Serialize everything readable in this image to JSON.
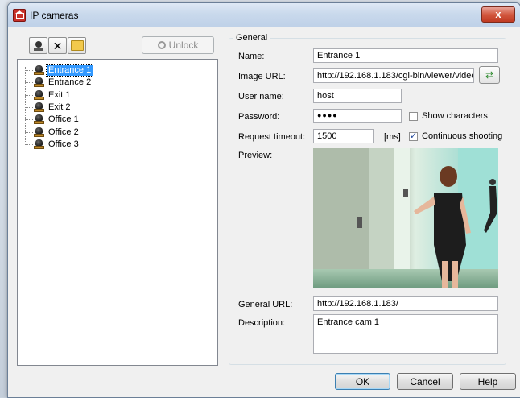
{
  "window": {
    "title": "IP cameras",
    "close_glyph": "x"
  },
  "toolbar": {
    "add_icon": "camera-add-icon",
    "delete_icon": "delete-x-icon",
    "folder_icon": "open-folder-icon",
    "unlock_label": "Unlock"
  },
  "cameras": [
    "Entrance 1",
    "Entrance 2",
    "Exit 1",
    "Exit 2",
    "Office 1",
    "Office 2",
    "Office 3"
  ],
  "selected_camera": "Entrance 1",
  "general": {
    "group_title": "General",
    "name_label": "Name:",
    "name_value": "Entrance 1",
    "image_url_label": "Image URL:",
    "image_url_value": "http://192.168.1.183/cgi-bin/viewer/videc",
    "user_label": "User name:",
    "user_value": "host",
    "password_label": "Password:",
    "password_value": "●●●●",
    "show_chars_label": "Show characters",
    "show_chars_checked": false,
    "timeout_label": "Request timeout:",
    "timeout_value": "1500",
    "timeout_unit": "[ms]",
    "continuous_label": "Continuous shooting",
    "continuous_checked": true,
    "preview_label": "Preview:",
    "general_url_label": "General URL:",
    "general_url_value": "http://192.168.1.183/",
    "description_label": "Description:",
    "description_value": "Entrance cam 1"
  },
  "buttons": {
    "ok": "OK",
    "cancel": "Cancel",
    "help": "Help"
  }
}
